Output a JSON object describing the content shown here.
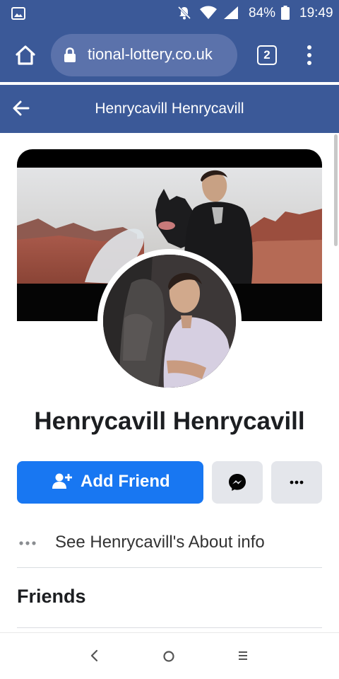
{
  "status_bar": {
    "battery_percent": "84%",
    "time": "19:49",
    "icons": [
      "gallery-icon",
      "mute-icon",
      "wifi-icon",
      "signal-icon",
      "battery-icon"
    ]
  },
  "browser": {
    "url": "tional-lottery.co.uk",
    "tab_count": "2",
    "icons": [
      "home-icon",
      "lock-icon",
      "tabs-icon",
      "overflow-menu-icon"
    ]
  },
  "header": {
    "title": "Henrycavill Henrycavill",
    "back_icon": "back-arrow-icon"
  },
  "profile": {
    "name": "Henrycavill Henrycavill",
    "cover_photo": "cover-photo",
    "profile_photo": "profile-photo"
  },
  "actions": {
    "add_friend_label": "Add Friend",
    "add_friend_icon": "add-friend-icon",
    "messenger_icon": "messenger-icon",
    "more_icon": "more-icon"
  },
  "about": {
    "label": "See Henrycavill's About info"
  },
  "sections": {
    "friends_heading": "Friends"
  },
  "nav_bar": {
    "icons": [
      "back-nav-icon",
      "home-nav-icon",
      "recents-nav-icon"
    ]
  },
  "colors": {
    "brand_blue": "#3b5998",
    "button_blue": "#1877f2",
    "secondary_button": "#e4e6eb"
  }
}
